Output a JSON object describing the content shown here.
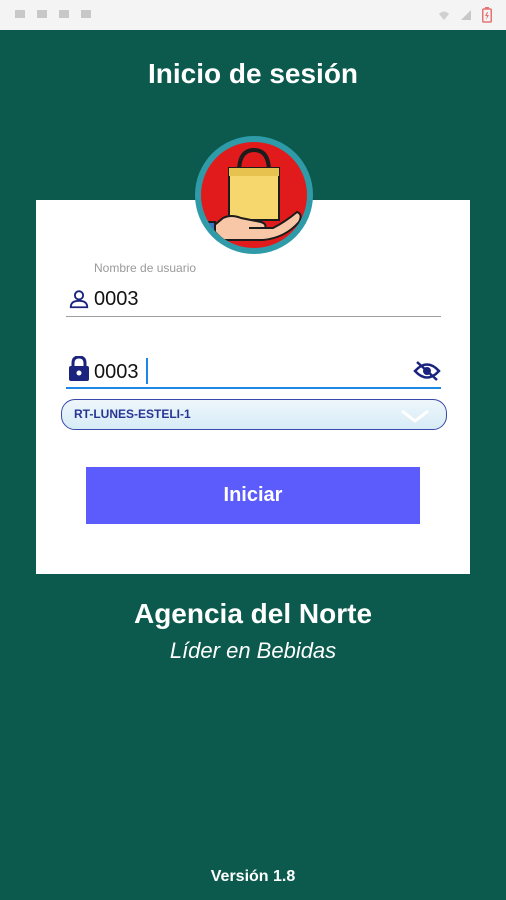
{
  "header": {
    "title": "Inicio de sesión"
  },
  "login_form": {
    "username_label": "Nombre de usuario",
    "username_value": "0003",
    "password_value": "0003",
    "route_selected": "RT-LUNES-ESTELI-1",
    "submit_label": "Iniciar"
  },
  "branding": {
    "company": "Agencia del Norte",
    "tagline": "Líder en Bebidas"
  },
  "footer": {
    "version": "Versión 1.8"
  },
  "icons": [
    "user-icon",
    "lock-icon",
    "eye-off-icon",
    "chevron-down-icon",
    "shopping-bag-hand-logo",
    "battery-icon",
    "signal-icon",
    "wifi-icon"
  ],
  "colors": {
    "background": "#0b5a4d",
    "card": "#ffffff",
    "button": "#5b5cfb",
    "accent_blue": "#1e88e5",
    "icon_blue": "#1a237e"
  }
}
